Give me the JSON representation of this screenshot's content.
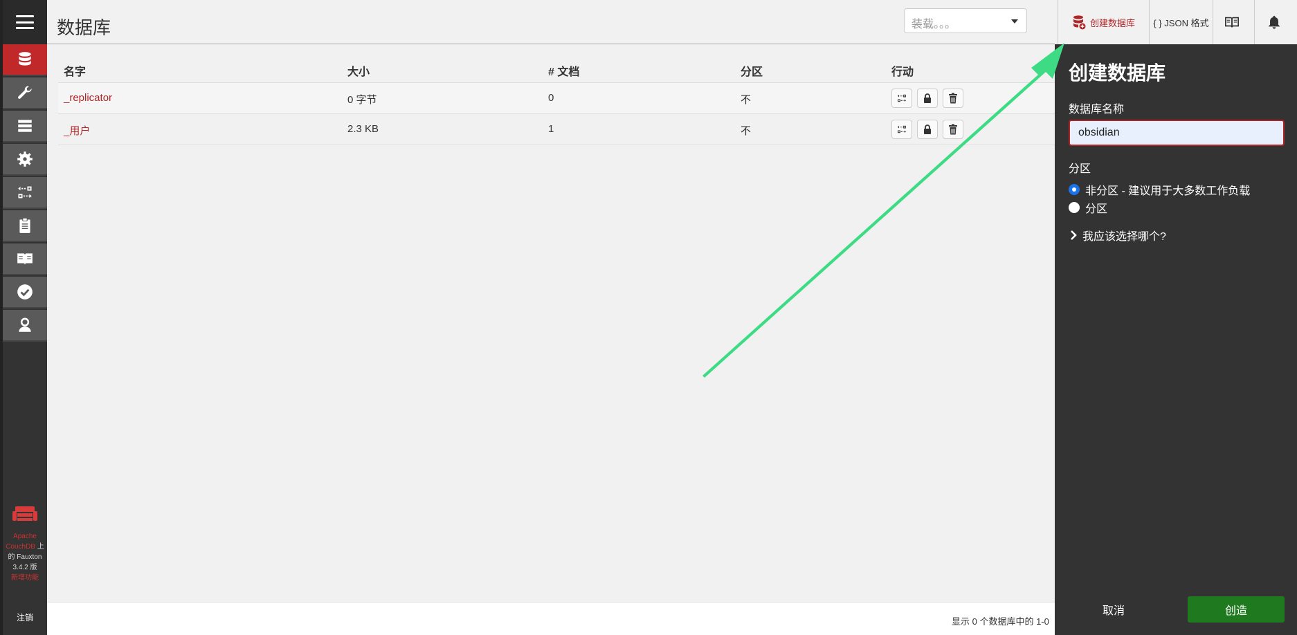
{
  "header": {
    "title": "数据库",
    "load_placeholder": "装载。。。",
    "create_db_label": "创建数据库",
    "json_label": "{ } JSON 格式"
  },
  "nav": {
    "brand_line1": "Apache",
    "brand_line2": "CouchDB",
    "brand_line2_suffix": " 上",
    "brand_line3": "的 Fauxton",
    "brand_line4": "3.4.2 版",
    "brand_line5": "新增功能",
    "logout_label": "注销"
  },
  "table": {
    "columns": [
      "名字",
      "大小",
      "# 文档",
      "分区",
      "行动"
    ],
    "rows": [
      {
        "name": "_replicator",
        "size": "0 字节",
        "docs": "0",
        "partitioned": "不"
      },
      {
        "name": "_用户",
        "size": "2.3 KB",
        "docs": "1",
        "partitioned": "不"
      }
    ]
  },
  "footer": {
    "text": "显示 0 个数据库中的 1-0"
  },
  "tray": {
    "title": "创建数据库",
    "name_label": "数据库名称",
    "name_value": "obsidian",
    "partition_label": "分区",
    "option_non_partitioned": "非分区 - 建议用于大多数工作负载",
    "option_partitioned": "分区",
    "help_link": "我应该选择哪个?",
    "cancel_label": "取消",
    "create_label": "创造"
  },
  "colors": {
    "accent_red": "#c0282a",
    "create_green": "#1f7a1f",
    "annotation_arrow": "#3ddc84"
  }
}
